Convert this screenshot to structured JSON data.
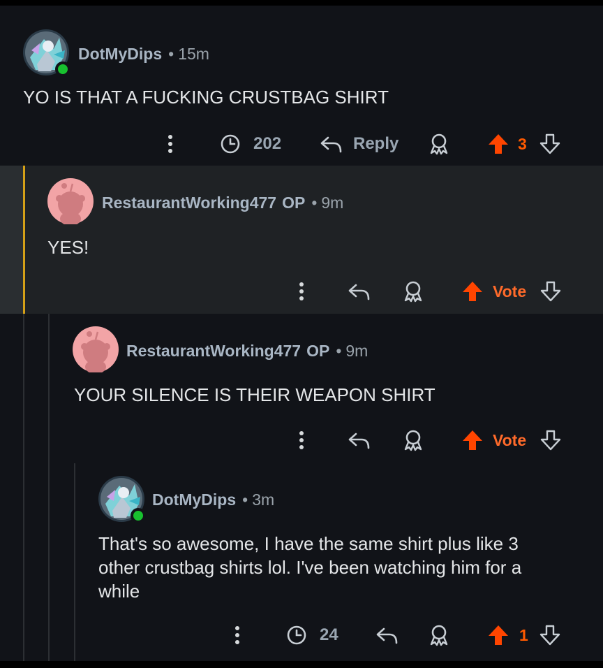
{
  "colors": {
    "accent": "#ff4500",
    "online": "#18c12f",
    "username": "#a9b6c4",
    "highlight_rail": "#d4a017"
  },
  "comments": [
    {
      "username": "DotMyDips",
      "op": "",
      "separator": "•",
      "time": "15m",
      "body": "YO IS THAT A FUCKING CRUSTBAG SHIRT",
      "views": "202",
      "reply_label": "Reply",
      "score": "3",
      "avatar": "snoo-avatar-custom",
      "online": true
    },
    {
      "username": "RestaurantWorking477",
      "op": "OP",
      "separator": "•",
      "time": "9m",
      "body": "YES!",
      "score": "Vote",
      "avatar": "snoo-avatar-default",
      "online": false
    },
    {
      "username": "RestaurantWorking477",
      "op": "OP",
      "separator": "•",
      "time": "9m",
      "body": "YOUR SILENCE IS THEIR WEAPON SHIRT",
      "score": "Vote",
      "avatar": "snoo-avatar-default",
      "online": false
    },
    {
      "username": "DotMyDips",
      "op": "",
      "separator": "•",
      "time": "3m",
      "body_lines": [
        "That's so awesome, I have the same shirt plus like 3",
        "other crustbag shirts lol. I've been watching him for a",
        "while"
      ],
      "views": "24",
      "score": "1",
      "avatar": "snoo-avatar-custom",
      "online": true
    }
  ],
  "icons": [
    "more-vert-icon",
    "clock-icon",
    "reply-arrow-icon",
    "award-icon",
    "upvote-icon",
    "downvote-icon"
  ]
}
